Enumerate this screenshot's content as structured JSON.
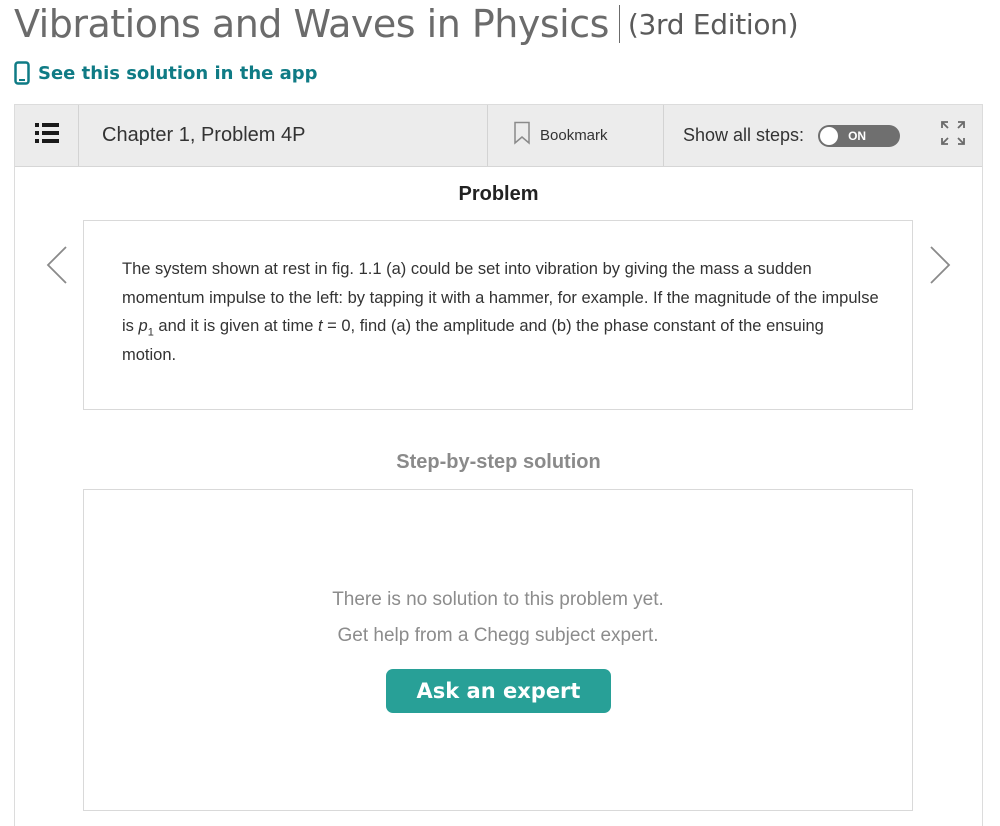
{
  "book": {
    "title": "Vibrations and Waves in Physics",
    "edition": "(3rd Edition)"
  },
  "app_link": {
    "label": "See this solution in the app",
    "icon": "phone-icon",
    "color": "#0f7b85"
  },
  "toolbar": {
    "menu_icon": "list-menu-icon",
    "chapter": "Chapter 1, Problem 4P",
    "bookmark_label": "Bookmark",
    "show_steps_label": "Show all steps:",
    "toggle_state": "ON",
    "expand_icon": "expand-icon"
  },
  "problem": {
    "heading": "Problem",
    "text_1": "The system shown at rest in fig. 1.1 (a) could be set into vibration by giving the mass a sudden momentum impulse to the left: by tapping it with a hammer, for example. If the magnitude of the impulse is ",
    "var_p": "p",
    "sub_1": "1",
    "text_2": " and it is given at time ",
    "var_t": "t",
    "text_3": " = 0, find (a) the amplitude and (b) the phase constant of the ensuing motion."
  },
  "solution": {
    "heading": "Step-by-step solution",
    "line_1": "There is no solution to this problem yet.",
    "line_2": "Get help from a Chegg subject expert.",
    "button_label": "Ask an expert",
    "button_color": "#28a097"
  }
}
